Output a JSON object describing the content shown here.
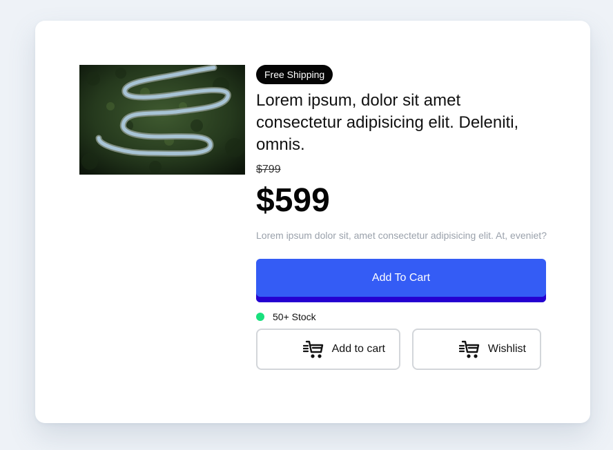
{
  "product": {
    "badge": "Free Shipping",
    "title": "Lorem ipsum, dolor sit amet consectetur adipisicing elit. Deleniti, omnis.",
    "old_price": "$799",
    "price": "$599",
    "description": "Lorem ipsum dolor sit, amet consectetur adipisicing elit. At, eveniet?",
    "image_alt": "aerial view of winding road through forest"
  },
  "actions": {
    "primary_label": "Add To Cart",
    "add_to_cart_label": "Add to cart",
    "wishlist_label": "Wishlist"
  },
  "stock": {
    "label": "50+ Stock",
    "color": "#19e07d"
  },
  "colors": {
    "primary": "#345cf5",
    "primary_shadow": "#2500d0",
    "badge_bg": "#050505"
  },
  "icons": {
    "cart": "cart-icon",
    "wishlist": "cart-icon"
  }
}
